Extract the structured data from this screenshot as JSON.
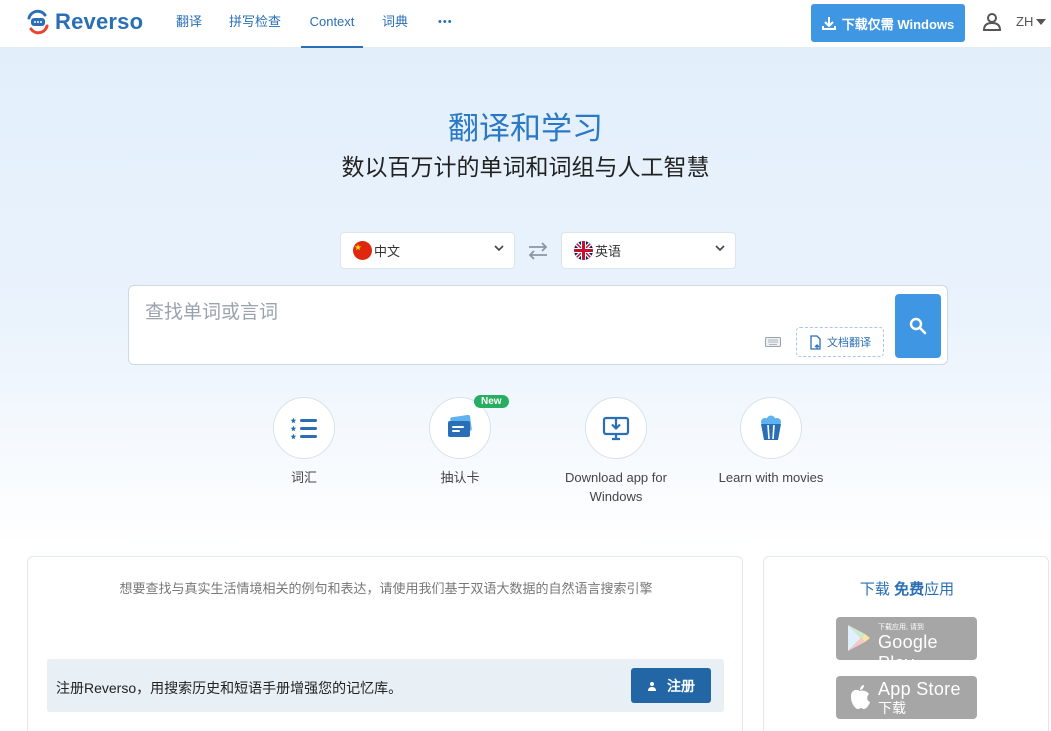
{
  "header": {
    "logo_text": "Reverso",
    "nav": [
      "翻译",
      "拼写检查",
      "Context",
      "词典"
    ],
    "more_label": "•••",
    "download_label": "下载仅需 Windows",
    "language": "ZH"
  },
  "hero": {
    "title": "翻译和学习",
    "subtitle": "数以百万计的单词和词组与人工智慧"
  },
  "translator": {
    "source_lang": "中文",
    "target_lang": "英语",
    "search_placeholder": "查找单词或言词",
    "doc_translate_label": "文档翻译"
  },
  "features": [
    {
      "label": "词汇",
      "icon": "vocabulary-list-icon"
    },
    {
      "label": "抽认卡",
      "icon": "flashcards-icon",
      "badge": "New"
    },
    {
      "label": "Download app for Windows",
      "icon": "download-app-icon"
    },
    {
      "label": "Learn with movies",
      "icon": "popcorn-icon"
    }
  ],
  "promo": {
    "text": "想要查找与真实生活情境相关的例句和表达，请使用我们基于双语大数据的自然语言搜索引擎",
    "register_text": "注册Reverso，用搜索历史和短语手册增强您的记忆库。",
    "register_button": "注册"
  },
  "apps": {
    "title_prefix": "下载",
    "title_bold": "免费",
    "title_suffix": "应用",
    "google_small": "下载应用, 请到",
    "google_big": "Google Play",
    "apple_big": "App Store",
    "apple_small": "下载"
  },
  "colors": {
    "brand_blue": "#2a6fb5",
    "button_blue": "#3f97e3",
    "register_blue": "#2266a6",
    "badge_green": "#27ae60"
  }
}
